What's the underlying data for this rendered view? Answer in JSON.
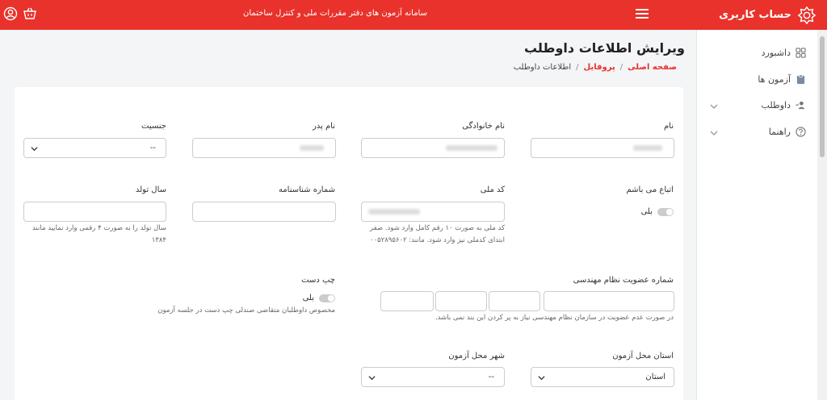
{
  "header": {
    "brand": "حساب کاربری",
    "system_title": "سامانه آزمون های دفتر مقررات ملی و کنترل ساختمان",
    "icons": [
      "brand-logo-icon",
      "hamburger-icon",
      "cart-icon",
      "user-icon"
    ]
  },
  "sidebar": {
    "items": [
      {
        "label": "داشبورد",
        "icon": "grid-icon"
      },
      {
        "label": "آزمون ها",
        "icon": "clipboard-icon"
      },
      {
        "label": "داوطلب",
        "icon": "user-check-icon",
        "expandable": true
      },
      {
        "label": "راهنما",
        "icon": "help-icon",
        "expandable": true
      }
    ]
  },
  "page": {
    "title": "ویرایش اطلاعات داوطلب",
    "breadcrumb": [
      "صفحه اصلی",
      "پروفایل",
      "اطلاعات داوطلب"
    ]
  },
  "form": {
    "name_label": "نام",
    "family_label": "نام خانوادگی",
    "father_label": "نام پدر",
    "gender_label": "جنسیت",
    "gender_value": "--",
    "citizen_label": "اتباع می باشم",
    "citizen_toggle": "بلی",
    "national_code_label": "کد ملی",
    "national_code_help": "کد ملی به صورت ۱۰ رقم کامل وارد شود. صفر ابتدای کدملی نیز وارد شود. مانند: ۰۰۵۲۸۹۵۶۰۲",
    "id_number_label": "شماره شناسنامه",
    "birth_year_label": "سال تولد",
    "birth_year_help": "سال تولد را به صورت ۴ رقمی وارد نمایید مانند ۱۳۸۴",
    "membership_label": "شماره عضویت نظام مهندسی",
    "membership_help": "در صورت عدم عضویت در سازمان نظام مهندسی نیاز به پر کردن این بند نمی باشد.",
    "left_handed_label": "چپ دست",
    "left_handed_toggle": "بلی",
    "left_handed_help": "مخصوص داوطلبان متقاضی صندلی چپ دست در جلسه آزمون",
    "exam_province_label": "استان محل آزمون",
    "exam_province_value": "استان",
    "exam_city_label": "شهر محل آزمون",
    "exam_city_value": "--"
  },
  "colors": {
    "accent": "#e8322b"
  }
}
